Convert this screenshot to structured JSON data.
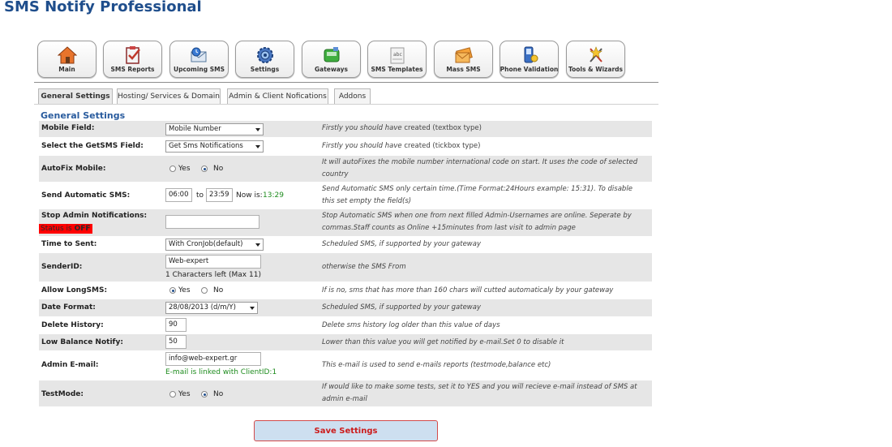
{
  "app": {
    "title": "SMS Notify Professional"
  },
  "toolbar": {
    "items": [
      {
        "label": "Main",
        "icon": "house-icon"
      },
      {
        "label": "SMS Reports",
        "icon": "clipboard-check-icon"
      },
      {
        "label": "Upcoming SMS",
        "icon": "envelope-clock-icon"
      },
      {
        "label": "Settings",
        "icon": "gear-icon"
      },
      {
        "label": "Gateways",
        "icon": "gateway-icon"
      },
      {
        "label": "SMS Templates",
        "icon": "template-icon"
      },
      {
        "label": "Mass SMS",
        "icon": "envelopes-icon"
      },
      {
        "label": "Phone Validation",
        "icon": "phone-icon"
      },
      {
        "label": "Tools & Wizards",
        "icon": "tools-icon"
      }
    ]
  },
  "tabs": [
    {
      "label": "General Settings",
      "active": true
    },
    {
      "label": "Hosting/ Services & Domain",
      "active": false
    },
    {
      "label": "Admin & Client Nofications",
      "active": false
    },
    {
      "label": "Addons",
      "active": false
    }
  ],
  "section": {
    "title": "General Settings"
  },
  "rows": {
    "mobile_field": {
      "label": "Mobile Field:",
      "value": "Mobile Number",
      "desc_pre": "Firstly you should have ",
      "desc_em": "created (textbox type)"
    },
    "getsms_field": {
      "label": "Select the GetSMS Field:",
      "value": "Get Sms Notifications",
      "desc_pre": "Firstly you should have ",
      "desc_em": "created (tickbox type)"
    },
    "autofix": {
      "label": "AutoFix Mobile:",
      "opt_yes": "Yes",
      "opt_no": "No",
      "selected": "No",
      "desc": "It will autoFixes the mobile number international code on start. It uses the code of selected country"
    },
    "send_auto": {
      "label": "Send Automatic SMS:",
      "from": "06:00",
      "to_label": "to",
      "to": "23:59",
      "now_label": "Now is:",
      "now": "13:29",
      "desc": "Send Automatic SMS only certain time.(Time Format:24Hours example: 15:31). To disable this set empty the field(s)"
    },
    "stop_admin": {
      "label": "Stop Admin Notifications:",
      "status_label": "Status is",
      "status_value": "OFF",
      "value": "",
      "desc": "Stop Automatic SMS when one from next filled Admin-Usernames are online. Seperate by commas.Staff counts as Online +15minutes from last visit to admin page"
    },
    "time_to_sent": {
      "label": "Time to Sent:",
      "value": "With CronJob(default)",
      "desc": "Scheduled SMS, if supported by your gateway"
    },
    "sender_id": {
      "label": "SenderID:",
      "value": "Web-expert",
      "chars_left": "1 Characters left (Max 11)",
      "desc": "otherwise the SMS From"
    },
    "long_sms": {
      "label": "Allow LongSMS:",
      "opt_yes": "Yes",
      "opt_no": "No",
      "selected": "Yes",
      "desc": "If is no, sms that has more than 160 chars will cutted automaticaly by your gateway"
    },
    "date_format": {
      "label": "Date Format:",
      "value": "28/08/2013 (d/m/Y)",
      "desc": "Scheduled SMS, if supported by your gateway"
    },
    "delete_history": {
      "label": "Delete History:",
      "value": "90",
      "desc": "Delete sms history log older than this value of days"
    },
    "low_balance": {
      "label": "Low Balance Notify:",
      "value": "50",
      "desc": "Lower than this value you will get notified by e-mail.Set 0 to disable it"
    },
    "admin_email": {
      "label": "Admin E-mail:",
      "value": "info@web-expert.gr",
      "linked": "E-mail is linked with ClientID:1",
      "desc": "This e-mail is used to send e-mails reports (testmode,balance etc)"
    },
    "test_mode": {
      "label": "TestMode:",
      "opt_yes": "Yes",
      "opt_no": "No",
      "selected": "No",
      "desc": "If would like to make some tests, set it to YES and you will recieve e-mail instead of SMS at admin e-mail"
    }
  },
  "actions": {
    "save_label": "Save Settings"
  },
  "colors": {
    "title": "#1f4e8c",
    "status_off_bg": "#ff0000",
    "save_text": "#cc1b1b",
    "green_text": "#1e8c1e"
  }
}
